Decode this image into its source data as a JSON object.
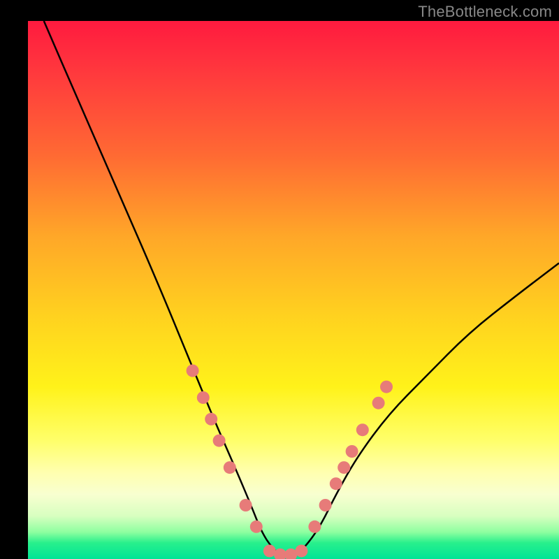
{
  "watermark": "TheBottleneck.com",
  "chart_data": {
    "type": "line",
    "title": "",
    "xlabel": "",
    "ylabel": "",
    "xlim": [
      0,
      100
    ],
    "ylim": [
      0,
      100
    ],
    "gradient_stops": [
      {
        "pos": 0,
        "color": "#ff1a3f"
      },
      {
        "pos": 10,
        "color": "#ff3a3d"
      },
      {
        "pos": 25,
        "color": "#ff6a33"
      },
      {
        "pos": 40,
        "color": "#ffa728"
      },
      {
        "pos": 55,
        "color": "#ffd21f"
      },
      {
        "pos": 68,
        "color": "#fff21a"
      },
      {
        "pos": 78,
        "color": "#ffff6a"
      },
      {
        "pos": 84,
        "color": "#ffffb0"
      },
      {
        "pos": 88,
        "color": "#f8ffd0"
      },
      {
        "pos": 92,
        "color": "#d8ffc0"
      },
      {
        "pos": 95,
        "color": "#8effa0"
      },
      {
        "pos": 97,
        "color": "#28f08c"
      },
      {
        "pos": 100,
        "color": "#00e496"
      }
    ],
    "series": [
      {
        "name": "v-curve",
        "x": [
          3,
          10,
          18,
          25,
          30,
          35,
          39,
          42,
          44,
          46,
          48,
          50,
          52,
          55,
          58,
          62,
          68,
          75,
          83,
          92,
          100
        ],
        "y": [
          100,
          84,
          66,
          50,
          38,
          26,
          17,
          10,
          5,
          2,
          0.5,
          0.5,
          2,
          6,
          12,
          19,
          27,
          34,
          42,
          49,
          55
        ]
      }
    ],
    "markers": {
      "left_arm": [
        {
          "x": 31,
          "y": 35
        },
        {
          "x": 33,
          "y": 30
        },
        {
          "x": 34.5,
          "y": 26
        },
        {
          "x": 36,
          "y": 22
        },
        {
          "x": 38,
          "y": 17
        },
        {
          "x": 41,
          "y": 10
        },
        {
          "x": 43,
          "y": 6
        }
      ],
      "bottom": [
        {
          "x": 45.5,
          "y": 1.5
        },
        {
          "x": 47.5,
          "y": 0.8
        },
        {
          "x": 49.5,
          "y": 0.8
        },
        {
          "x": 51.5,
          "y": 1.5
        }
      ],
      "right_arm": [
        {
          "x": 54,
          "y": 6
        },
        {
          "x": 56,
          "y": 10
        },
        {
          "x": 58,
          "y": 14
        },
        {
          "x": 59.5,
          "y": 17
        },
        {
          "x": 61,
          "y": 20
        },
        {
          "x": 63,
          "y": 24
        },
        {
          "x": 66,
          "y": 29
        },
        {
          "x": 67.5,
          "y": 32
        }
      ]
    },
    "marker_style": {
      "r": 9,
      "fill": "#e77b79"
    },
    "curve_style": {
      "stroke": "#000000",
      "stroke_width": 2.5
    }
  }
}
